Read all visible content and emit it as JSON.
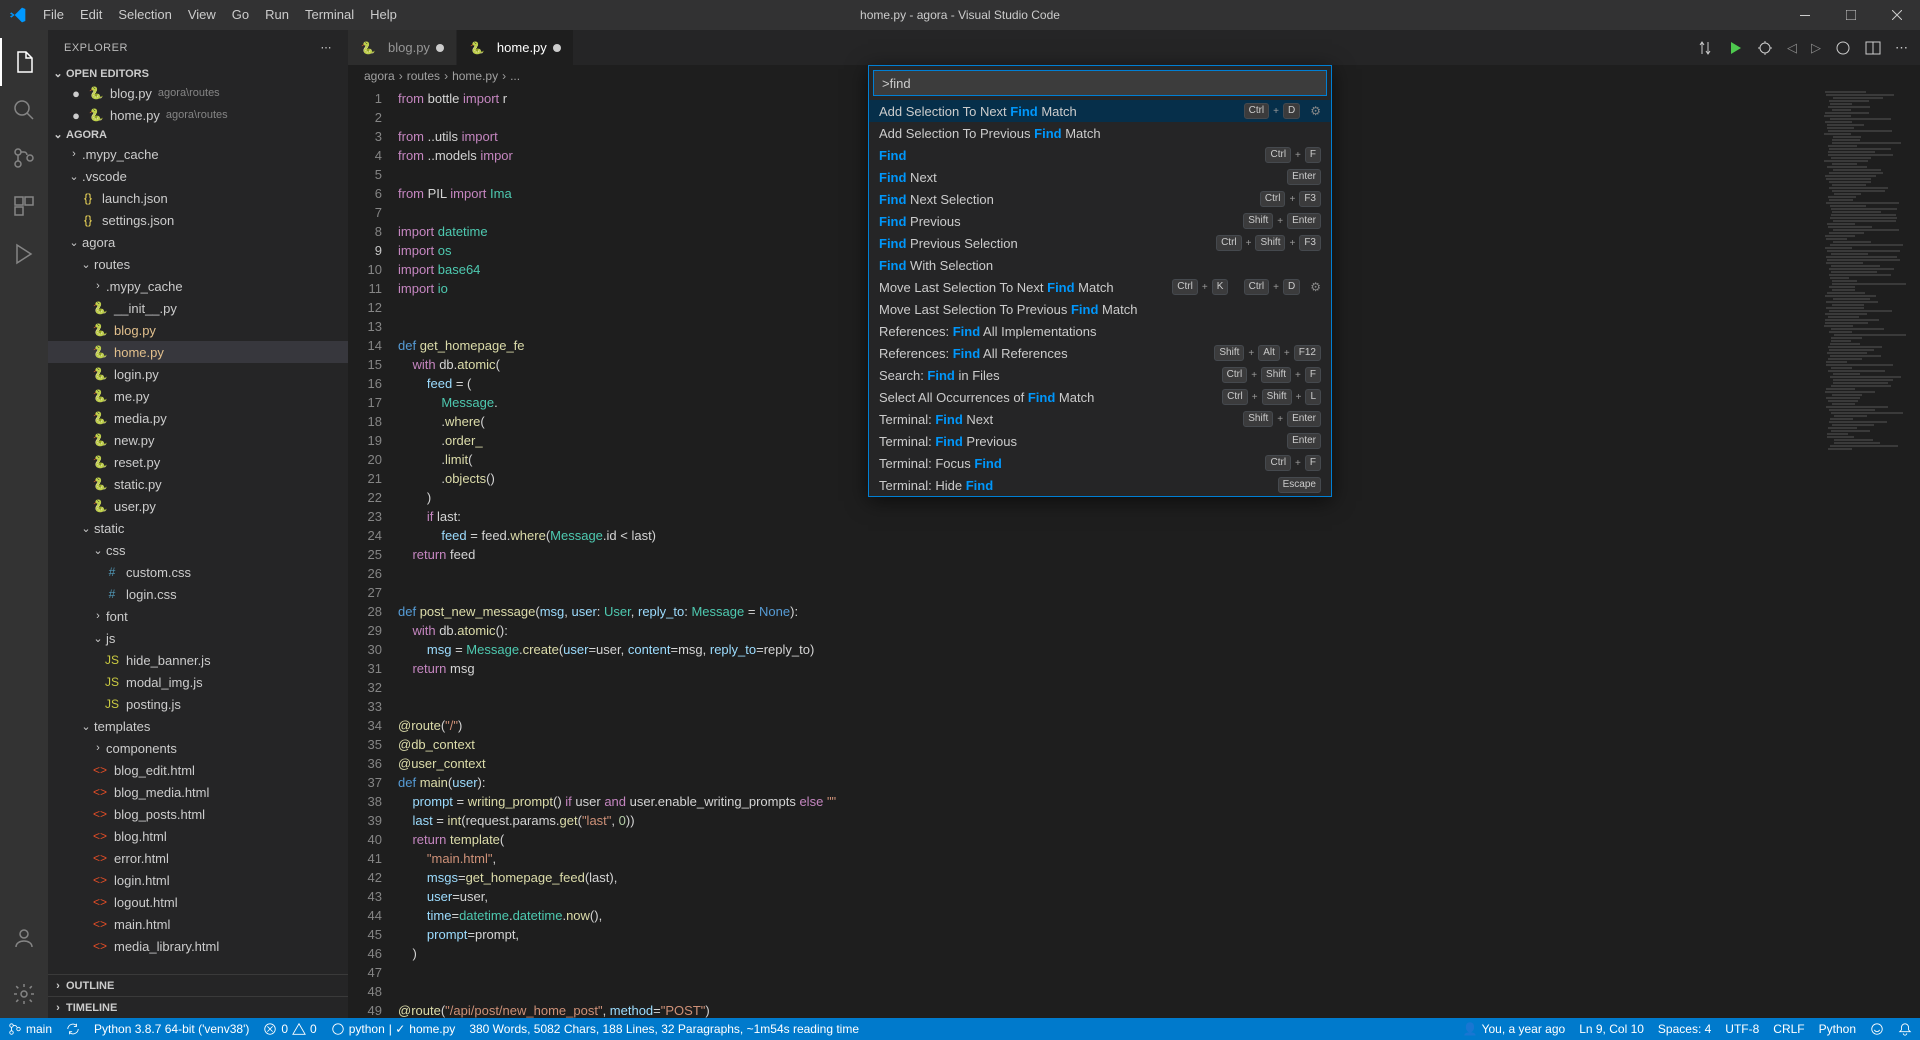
{
  "title": "home.py - agora - Visual Studio Code",
  "menu": [
    "File",
    "Edit",
    "Selection",
    "View",
    "Go",
    "Run",
    "Terminal",
    "Help"
  ],
  "sidebar": {
    "title": "EXPLORER",
    "sections": {
      "openEditors": "OPEN EDITORS",
      "workspace": "AGORA",
      "outline": "OUTLINE",
      "timeline": "TIMELINE"
    },
    "openEditorItems": [
      {
        "name": "blog.py",
        "detail": "agora\\routes",
        "mod": true,
        "icon": "py"
      },
      {
        "name": "home.py",
        "detail": "agora\\routes",
        "mod": true,
        "icon": "py"
      }
    ],
    "tree": [
      {
        "t": "folder",
        "name": ".mypy_cache",
        "depth": 1,
        "open": false
      },
      {
        "t": "folder",
        "name": ".vscode",
        "depth": 1,
        "open": true
      },
      {
        "t": "file",
        "name": "launch.json",
        "depth": 2,
        "icon": "json"
      },
      {
        "t": "file",
        "name": "settings.json",
        "depth": 2,
        "icon": "json"
      },
      {
        "t": "folder",
        "name": "agora",
        "depth": 1,
        "open": true
      },
      {
        "t": "folder",
        "name": "routes",
        "depth": 2,
        "open": true
      },
      {
        "t": "folder",
        "name": ".mypy_cache",
        "depth": 3,
        "open": false
      },
      {
        "t": "file",
        "name": "__init__.py",
        "depth": 3,
        "icon": "py"
      },
      {
        "t": "file",
        "name": "blog.py",
        "depth": 3,
        "icon": "py",
        "mod": true
      },
      {
        "t": "file",
        "name": "home.py",
        "depth": 3,
        "icon": "py",
        "active": true,
        "mod": true
      },
      {
        "t": "file",
        "name": "login.py",
        "depth": 3,
        "icon": "py"
      },
      {
        "t": "file",
        "name": "me.py",
        "depth": 3,
        "icon": "py"
      },
      {
        "t": "file",
        "name": "media.py",
        "depth": 3,
        "icon": "py"
      },
      {
        "t": "file",
        "name": "new.py",
        "depth": 3,
        "icon": "py"
      },
      {
        "t": "file",
        "name": "reset.py",
        "depth": 3,
        "icon": "py"
      },
      {
        "t": "file",
        "name": "static.py",
        "depth": 3,
        "icon": "py"
      },
      {
        "t": "file",
        "name": "user.py",
        "depth": 3,
        "icon": "py"
      },
      {
        "t": "folder",
        "name": "static",
        "depth": 2,
        "open": true
      },
      {
        "t": "folder",
        "name": "css",
        "depth": 3,
        "open": true
      },
      {
        "t": "file",
        "name": "custom.css",
        "depth": 4,
        "icon": "css"
      },
      {
        "t": "file",
        "name": "login.css",
        "depth": 4,
        "icon": "css"
      },
      {
        "t": "folder",
        "name": "font",
        "depth": 3,
        "open": false
      },
      {
        "t": "folder",
        "name": "js",
        "depth": 3,
        "open": true
      },
      {
        "t": "file",
        "name": "hide_banner.js",
        "depth": 4,
        "icon": "js"
      },
      {
        "t": "file",
        "name": "modal_img.js",
        "depth": 4,
        "icon": "js"
      },
      {
        "t": "file",
        "name": "posting.js",
        "depth": 4,
        "icon": "js"
      },
      {
        "t": "folder",
        "name": "templates",
        "depth": 2,
        "open": true
      },
      {
        "t": "folder",
        "name": "components",
        "depth": 3,
        "open": false
      },
      {
        "t": "file",
        "name": "blog_edit.html",
        "depth": 3,
        "icon": "html"
      },
      {
        "t": "file",
        "name": "blog_media.html",
        "depth": 3,
        "icon": "html"
      },
      {
        "t": "file",
        "name": "blog_posts.html",
        "depth": 3,
        "icon": "html"
      },
      {
        "t": "file",
        "name": "blog.html",
        "depth": 3,
        "icon": "html"
      },
      {
        "t": "file",
        "name": "error.html",
        "depth": 3,
        "icon": "html"
      },
      {
        "t": "file",
        "name": "login.html",
        "depth": 3,
        "icon": "html"
      },
      {
        "t": "file",
        "name": "logout.html",
        "depth": 3,
        "icon": "html"
      },
      {
        "t": "file",
        "name": "main.html",
        "depth": 3,
        "icon": "html"
      },
      {
        "t": "file",
        "name": "media_library.html",
        "depth": 3,
        "icon": "html"
      }
    ]
  },
  "tabs": [
    {
      "name": "blog.py",
      "mod": true,
      "icon": "py"
    },
    {
      "name": "home.py",
      "mod": true,
      "icon": "py",
      "active": true
    }
  ],
  "breadcrumb": [
    "agora",
    "routes",
    "home.py",
    "..."
  ],
  "palette": {
    "input": ">find",
    "items": [
      {
        "pre": "Add Selection To Next ",
        "m": "Find",
        "post": " Match",
        "keys": [
          "Ctrl",
          "D"
        ],
        "gear": true,
        "sel": true
      },
      {
        "pre": "Add Selection To Previous ",
        "m": "Find",
        "post": " Match"
      },
      {
        "pre": "",
        "m": "Find",
        "post": "",
        "keys": [
          "Ctrl",
          "F"
        ]
      },
      {
        "pre": "",
        "m": "Find",
        "post": " Next",
        "keys": [
          "Enter"
        ]
      },
      {
        "pre": "",
        "m": "Find",
        "post": " Next Selection",
        "keys": [
          "Ctrl",
          "F3"
        ]
      },
      {
        "pre": "",
        "m": "Find",
        "post": " Previous",
        "keys": [
          "Shift",
          "Enter"
        ]
      },
      {
        "pre": "",
        "m": "Find",
        "post": " Previous Selection",
        "keys": [
          "Ctrl",
          "Shift",
          "F3"
        ]
      },
      {
        "pre": "",
        "m": "Find",
        "post": " With Selection"
      },
      {
        "pre": "Move Last Selection To Next ",
        "m": "Find",
        "post": " Match",
        "chord": [
          [
            "Ctrl",
            "K"
          ],
          [
            "Ctrl",
            "D"
          ]
        ],
        "gear": true
      },
      {
        "pre": "Move Last Selection To Previous ",
        "m": "Find",
        "post": " Match"
      },
      {
        "pre": "References: ",
        "m": "Find",
        "post": " All Implementations"
      },
      {
        "pre": "References: ",
        "m": "Find",
        "post": " All References",
        "keys": [
          "Shift",
          "Alt",
          "F12"
        ]
      },
      {
        "pre": "Search: ",
        "m": "Find",
        "post": " in Files",
        "keys": [
          "Ctrl",
          "Shift",
          "F"
        ]
      },
      {
        "pre": "Select All Occurrences of ",
        "m": "Find",
        "post": " Match",
        "keys": [
          "Ctrl",
          "Shift",
          "L"
        ]
      },
      {
        "pre": "Terminal: ",
        "m": "Find",
        "post": " Next",
        "keys": [
          "Shift",
          "Enter"
        ]
      },
      {
        "pre": "Terminal: ",
        "m": "Find",
        "post": " Previous",
        "keys": [
          "Enter"
        ]
      },
      {
        "pre": "Terminal: Focus ",
        "m": "Find",
        "post": "",
        "keys": [
          "Ctrl",
          "F"
        ]
      },
      {
        "pre": "Terminal: Hide ",
        "m": "Find",
        "post": "",
        "keys": [
          "Escape"
        ]
      }
    ]
  },
  "status": {
    "branch": "main",
    "interpreter": "Python 3.8.7 64-bit ('venv38')",
    "errors": "0",
    "warnings": "0",
    "lsp": "python",
    "file": "home.py",
    "stats": "380 Words, 5082 Chars, 188 Lines, 32 Paragraphs, ~1m54s reading time",
    "blame": "You, a year ago",
    "pos": "Ln 9, Col 10",
    "spaces": "Spaces: 4",
    "enc": "UTF-8",
    "eol": "CRLF",
    "lang": "Python"
  },
  "code": {
    "currentLine": 9
  }
}
